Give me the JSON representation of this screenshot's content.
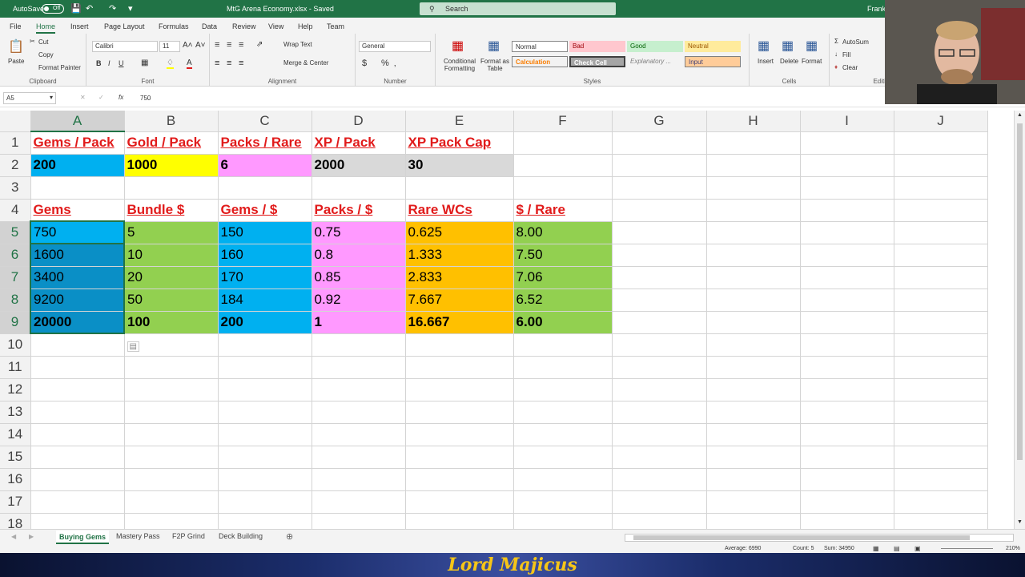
{
  "titlebar": {
    "autosave_label": "AutoSave",
    "autosave_state": "Off",
    "document_title": "MtG Arena Economy.xlsx  -  Saved",
    "search_placeholder": "Search",
    "user": "Frank"
  },
  "menu": [
    "File",
    "Home",
    "Insert",
    "Page Layout",
    "Formulas",
    "Data",
    "Review",
    "View",
    "Help",
    "Team"
  ],
  "ribbon": {
    "clipboard": {
      "paste": "Paste",
      "cut": "Cut",
      "copy": "Copy",
      "format_painter": "Format Painter",
      "label": "Clipboard"
    },
    "font": {
      "name": "Calibri",
      "size": "11",
      "label": "Font"
    },
    "alignment": {
      "wrap": "Wrap Text",
      "merge": "Merge & Center",
      "label": "Alignment"
    },
    "number": {
      "format": "General",
      "label": "Number"
    },
    "styles": {
      "conditional": "Conditional Formatting",
      "format_table": "Format as Table",
      "cells": [
        "Normal",
        "Bad",
        "Good",
        "Neutral",
        "Calculation",
        "Check Cell",
        "Explanatory ...",
        "Input"
      ],
      "label": "Styles"
    },
    "cells": {
      "insert": "Insert",
      "delete": "Delete",
      "format": "Format",
      "label": "Cells"
    },
    "editing": {
      "autosum": "AutoSum",
      "fill": "Fill",
      "clear": "Clear",
      "label": "Editi"
    }
  },
  "formula_bar": {
    "name_box": "A5",
    "value": "750"
  },
  "columns": [
    "A",
    "B",
    "C",
    "D",
    "E",
    "F",
    "G",
    "H",
    "I",
    "J"
  ],
  "rows": {
    "r1": [
      "Gems / Pack",
      "Gold / Pack",
      "Packs / Rare",
      "XP / Pack",
      "XP Pack Cap"
    ],
    "r2": [
      "200",
      "1000",
      "6",
      "2000",
      "30"
    ],
    "r4": [
      "Gems",
      "Bundle $",
      "Gems / $",
      "Packs / $",
      "Rare WCs",
      "$ / Rare"
    ],
    "data": [
      [
        "750",
        "5",
        "150",
        "0.75",
        "0.625",
        "8.00"
      ],
      [
        "1600",
        "10",
        "160",
        "0.8",
        "1.333",
        "7.50"
      ],
      [
        "3400",
        "20",
        "170",
        "0.85",
        "2.833",
        "7.06"
      ],
      [
        "9200",
        "50",
        "184",
        "0.92",
        "7.667",
        "6.52"
      ],
      [
        "20000",
        "100",
        "200",
        "1",
        "16.667",
        "6.00"
      ]
    ]
  },
  "sheets": [
    "Buying Gems",
    "Mastery Pass",
    "F2P Grind",
    "Deck Building"
  ],
  "status": {
    "average": "Average: 6990",
    "count": "Count: 5",
    "sum": "Sum: 34950",
    "zoom": "210%"
  },
  "banner": "Lord Majicus",
  "colors": {
    "blue": "#00b0f0",
    "blue_sel": "#0a8fc6",
    "yellow": "#ffff00",
    "pink": "#ff99ff",
    "grey": "#d9d9d9",
    "green": "#92d050",
    "orange": "#ffc000",
    "red": "#e11b1b",
    "excel_green": "#217346"
  }
}
